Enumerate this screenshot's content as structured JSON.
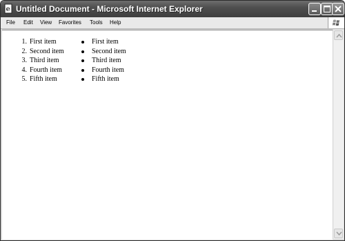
{
  "window": {
    "title": "Untitled Document - Microsoft Internet Explorer"
  },
  "menubar": {
    "items": [
      {
        "label": "File"
      },
      {
        "label": "Edit"
      },
      {
        "label": "View"
      },
      {
        "label": "Favorites"
      },
      {
        "label": "Tools"
      },
      {
        "label": "Help"
      }
    ]
  },
  "content": {
    "ordered_list": [
      {
        "marker": "1.",
        "text": "First item"
      },
      {
        "marker": "2.",
        "text": "Second item"
      },
      {
        "marker": "3.",
        "text": "Third item"
      },
      {
        "marker": "4.",
        "text": "Fourth item"
      },
      {
        "marker": "5.",
        "text": "Fifth item"
      }
    ],
    "unordered_list": [
      {
        "text": "First item"
      },
      {
        "text": "Second item"
      },
      {
        "text": "Third item"
      },
      {
        "text": "Fourth item"
      },
      {
        "text": "Fifth item"
      }
    ]
  },
  "icons": {
    "app": "ie-document-icon",
    "minimize": "minimize-icon",
    "maximize": "maximize-icon",
    "close": "close-icon",
    "throbber": "windows-logo-icon"
  }
}
